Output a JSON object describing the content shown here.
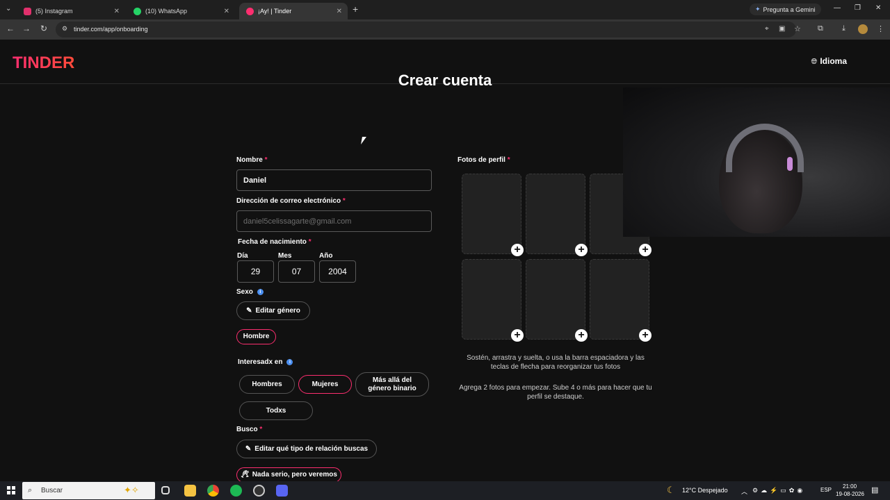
{
  "browser": {
    "tabs": [
      {
        "title": "(5) Instagram",
        "color": "#e1306c"
      },
      {
        "title": "(10) WhatsApp",
        "color": "#25d366"
      },
      {
        "title": "¡Ay! | Tinder",
        "color": "#fd2e6f"
      }
    ],
    "gemini_label": "Pregunta a Gemini",
    "url": "tinder.com/app/onboarding"
  },
  "header": {
    "logo": "TINDER",
    "language": "Idioma"
  },
  "form": {
    "title": "Crear cuenta",
    "name_label": "Nombre",
    "name_value": "Daniel",
    "email_label": "Dirección de correo electrónico",
    "email_placeholder": "daniel5celissagarte@gmail.com",
    "birth_label": "Fecha de nacimiento",
    "day_label": "Día",
    "day_value": "29",
    "month_label": "Mes",
    "month_value": "07",
    "year_label": "Año",
    "year_value": "2004",
    "sex_label": "Sexo",
    "edit_gender": "Editar género",
    "gender_selected": "Hombre",
    "interested_label": "Interesadx en",
    "interested_options": [
      "Hombres",
      "Mujeres",
      "Más allá del género binario",
      "Todxs"
    ],
    "interested_selected": "Mujeres",
    "looking_label": "Busco",
    "edit_relationship": "Editar qué tipo de relación buscas",
    "relationship_selected": "Nada serio, pero veremos",
    "required_mark": "*"
  },
  "photos": {
    "label": "Fotos de perfil",
    "hint1": "Sostén, arrastra y suelta, o usa la barra espaciadora y las teclas de flecha para reorganizar tus fotos",
    "hint2": "Agrega 2 fotos para empezar. Sube 4 o más para hacer que tu perfil se destaque."
  },
  "taskbar": {
    "search_placeholder": "Buscar",
    "weather": "12°C Despejado",
    "lang": "ESP",
    "time": "21:00",
    "date": "19-08-2026"
  }
}
